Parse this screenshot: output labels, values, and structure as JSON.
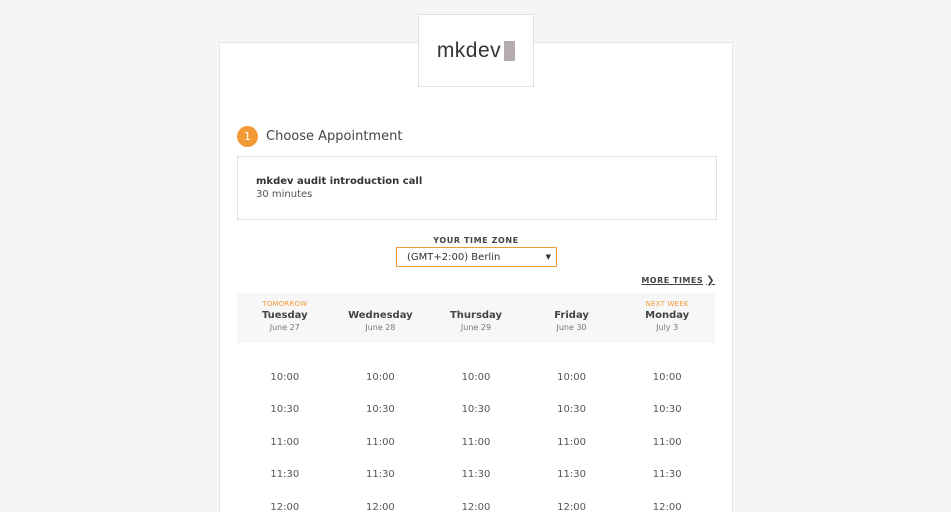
{
  "brand": {
    "logo_text": "mkdev",
    "accent_color": "#f29b36"
  },
  "step": {
    "number": "1",
    "title": "Choose Appointment"
  },
  "service": {
    "name": "mkdev audit introduction call",
    "duration": "30 minutes"
  },
  "timezone": {
    "label": "YOUR TIME ZONE",
    "selected": "(GMT+2:00) Berlin",
    "icon": "chevron-down-icon"
  },
  "more_times": {
    "label": "MORE TIMES",
    "icon": "chevron-right-icon"
  },
  "days": [
    {
      "tag": "TOMORROW",
      "name": "Tuesday",
      "date": "June 27",
      "slots": [
        "10:00",
        "10:30",
        "11:00",
        "11:30",
        "12:00"
      ]
    },
    {
      "tag": "",
      "name": "Wednesday",
      "date": "June 28",
      "slots": [
        "10:00",
        "10:30",
        "11:00",
        "11:30",
        "12:00"
      ]
    },
    {
      "tag": "",
      "name": "Thursday",
      "date": "June 29",
      "slots": [
        "10:00",
        "10:30",
        "11:00",
        "11:30",
        "12:00"
      ]
    },
    {
      "tag": "",
      "name": "Friday",
      "date": "June 30",
      "slots": [
        "10:00",
        "10:30",
        "11:00",
        "11:30",
        "12:00"
      ]
    },
    {
      "tag": "NEXT WEEK",
      "name": "Monday",
      "date": "July 3",
      "slots": [
        "10:00",
        "10:30",
        "11:00",
        "11:30",
        "12:00"
      ]
    }
  ]
}
